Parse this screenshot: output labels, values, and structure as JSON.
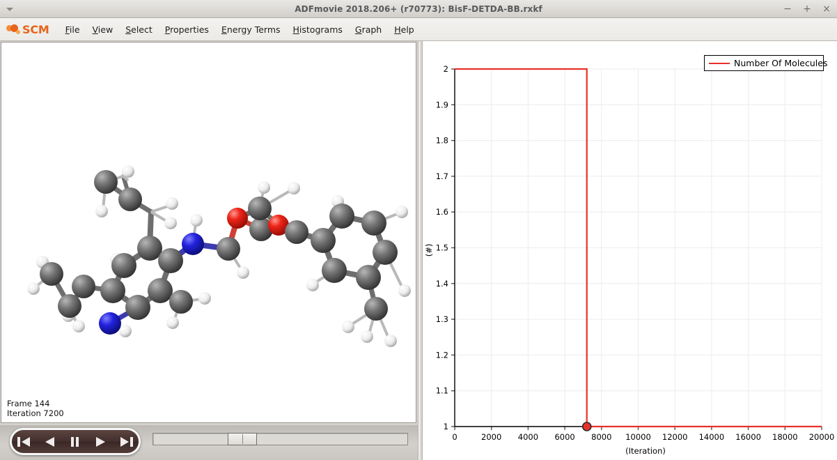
{
  "window": {
    "title": "ADFmovie 2018.206+ (r70773): BisF-DETDA-BB.rxkf",
    "minimize_label": "−",
    "maximize_label": "+",
    "close_label": "×",
    "menu_arrow_name": "window-menu-arrow"
  },
  "brand": {
    "name": "SCM"
  },
  "menubar": {
    "items": [
      {
        "label": "File",
        "mnemonic": "F"
      },
      {
        "label": "View",
        "mnemonic": "V"
      },
      {
        "label": "Select",
        "mnemonic": "S"
      },
      {
        "label": "Properties",
        "mnemonic": "P"
      },
      {
        "label": "Energy Terms",
        "mnemonic": "E"
      },
      {
        "label": "Histograms",
        "mnemonic": "H"
      },
      {
        "label": "Graph",
        "mnemonic": "G"
      },
      {
        "label": "Help",
        "mnemonic": "H"
      }
    ]
  },
  "viewer": {
    "frame_label": "Frame 144",
    "iteration_label": "Iteration 7200",
    "molecule_title": "BisF-DETDA-BB",
    "atom_colors": {
      "carbon": "#6b6b6b",
      "nitrogen": "#1414d2",
      "oxygen": "#e01010",
      "hydrogen": "#f2f2f2"
    }
  },
  "player": {
    "buttons": [
      {
        "name": "skip-to-start-button",
        "glyph": "skip-back"
      },
      {
        "name": "step-backward-button",
        "glyph": "rewind"
      },
      {
        "name": "pause-button",
        "glyph": "pause"
      },
      {
        "name": "play-button",
        "glyph": "play"
      },
      {
        "name": "skip-to-end-button",
        "glyph": "skip-forward"
      }
    ],
    "slider_position_percent": 33
  },
  "chart_data": {
    "type": "line",
    "title": "",
    "xlabel": "(Iteration)",
    "ylabel": "(#)",
    "xlim": [
      0,
      20000
    ],
    "ylim": [
      1,
      2
    ],
    "grid": true,
    "legend_position": "top-right",
    "x_ticks": [
      0,
      2000,
      4000,
      6000,
      8000,
      10000,
      12000,
      14000,
      16000,
      18000,
      20000
    ],
    "y_ticks": [
      1,
      1.1,
      1.2,
      1.3,
      1.4,
      1.5,
      1.6,
      1.7,
      1.8,
      1.9,
      2
    ],
    "series": [
      {
        "name": "Number Of Molecules",
        "color": "#e8312a",
        "x": [
          0,
          7200,
          7200,
          20000
        ],
        "values": [
          2,
          2,
          1,
          1
        ]
      }
    ],
    "markers": [
      {
        "x": 7200,
        "y": 1,
        "name": "current-frame-marker",
        "color": "#e8312a"
      }
    ]
  }
}
